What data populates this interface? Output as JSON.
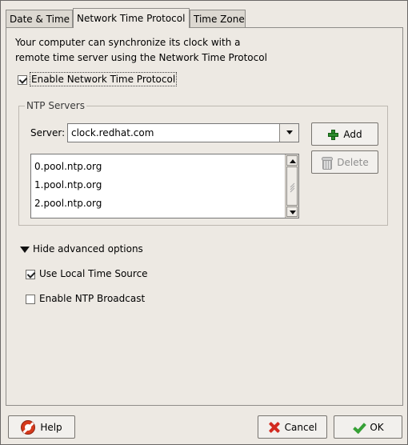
{
  "tabs": [
    {
      "label": "Date & Time"
    },
    {
      "label": "Network Time Protocol"
    },
    {
      "label": "Time Zone"
    }
  ],
  "description": {
    "line1": "Your computer can synchronize its clock with a",
    "line2": "remote time server using the Network Time Protocol"
  },
  "ntp_enable": {
    "label": "Enable Network Time Protocol",
    "checked": true
  },
  "ntp_servers": {
    "section_title": "NTP Servers",
    "server_label": "Server:",
    "server_value": "clock.redhat.com",
    "add_label": "Add",
    "delete_label": "Delete",
    "items": [
      "0.pool.ntp.org",
      "1.pool.ntp.org",
      "2.pool.ntp.org"
    ]
  },
  "advanced": {
    "toggle_label": "Hide advanced options",
    "use_local_time_source": {
      "label": "Use Local Time Source",
      "checked": true
    },
    "enable_ntp_broadcast": {
      "label": "Enable NTP Broadcast",
      "checked": false
    }
  },
  "footer": {
    "help_label": "Help",
    "cancel_label": "Cancel",
    "ok_label": "OK"
  },
  "icons": {
    "add": "plus-icon",
    "delete": "trash-icon",
    "help": "help-icon",
    "cancel": "cancel-icon",
    "ok": "ok-icon",
    "expander": "triangle-down-icon"
  },
  "colors": {
    "window_bg": "#ede9e3",
    "add_icon": "#2d8c2d",
    "cancel_icon": "#d22a1f",
    "ok_icon": "#36a036",
    "help_icon": "#d53a1c"
  }
}
